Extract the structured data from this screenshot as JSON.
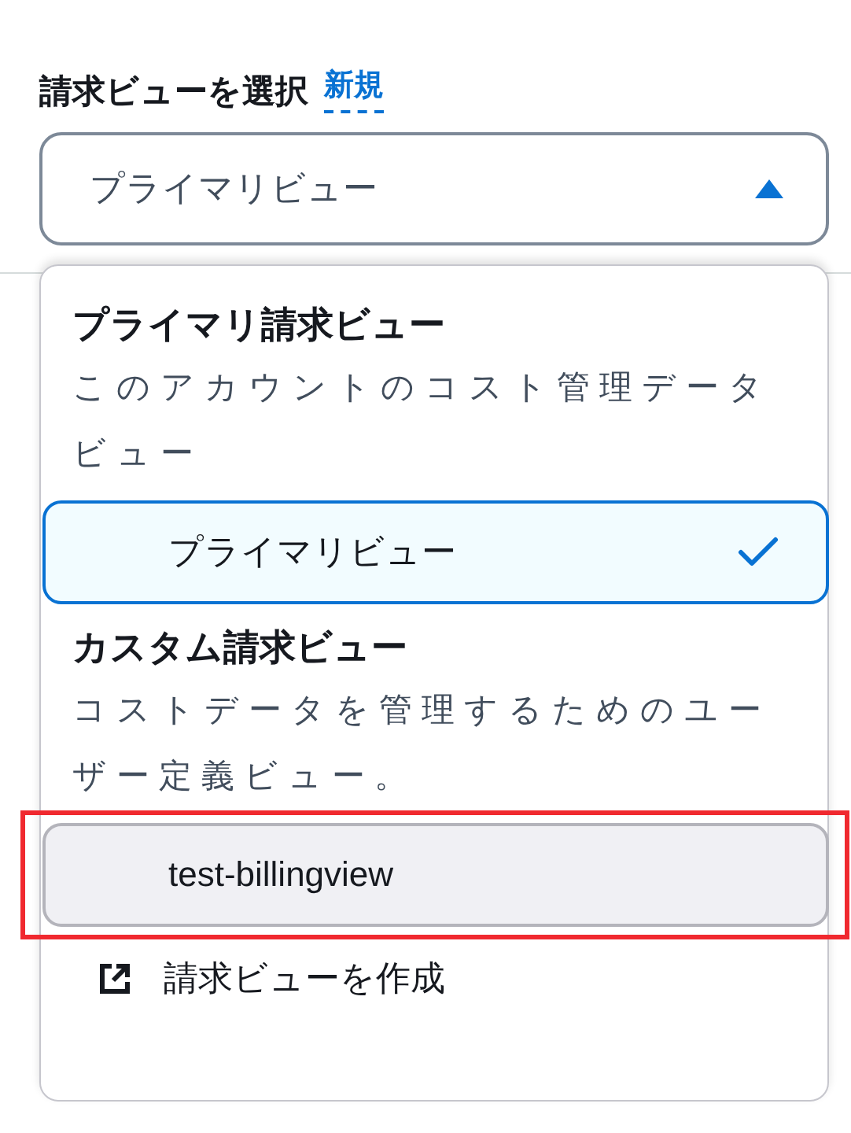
{
  "field": {
    "label": "請求ビューを選択",
    "link": "新規",
    "value": "プライマリビュー",
    "expanded": true
  },
  "groups": [
    {
      "title": "プライマリ請求ビュー",
      "description": "このアカウントのコスト管理データビュー",
      "options": [
        {
          "label": "プライマリビュー",
          "selected": true,
          "hovered": false,
          "annotated": false
        }
      ]
    },
    {
      "title": "カスタム請求ビュー",
      "description": "コストデータを管理するためのユーザー定義ビュー。",
      "options": [
        {
          "label": "test-billingview",
          "selected": false,
          "hovered": true,
          "annotated": true
        }
      ]
    }
  ],
  "footer_action": {
    "label": "請求ビューを作成"
  }
}
